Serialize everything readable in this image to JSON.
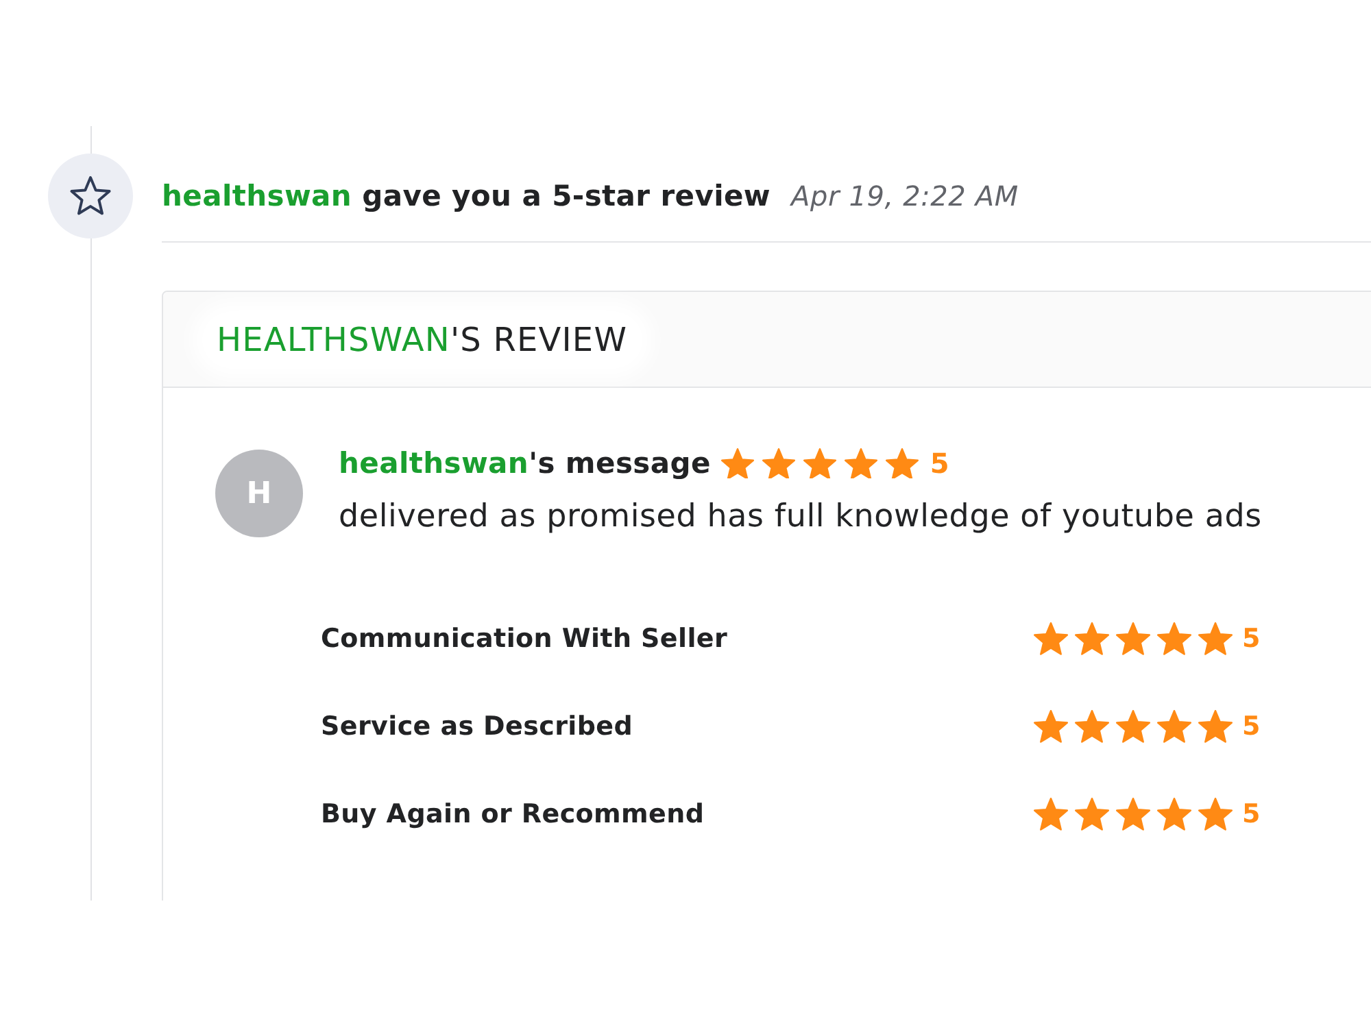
{
  "notification": {
    "username": "healthswan",
    "action": "gave you a 5-star review",
    "time": "Apr 19, 2:22 AM"
  },
  "review": {
    "title": {
      "username": "HEALTHSWAN",
      "suffix": "'S REVIEW"
    },
    "message": {
      "avatar_initial": "H",
      "username": "healthswan",
      "suffix": "'s message",
      "stars": 5,
      "score": "5",
      "text": "delivered as promised has full knowledge of youtube ads"
    },
    "ratings": [
      {
        "label": "Communication With Seller",
        "stars": 5,
        "score": "5"
      },
      {
        "label": "Service as Described",
        "stars": 5,
        "score": "5"
      },
      {
        "label": "Buy Again or Recommend",
        "stars": 5,
        "score": "5"
      }
    ]
  }
}
